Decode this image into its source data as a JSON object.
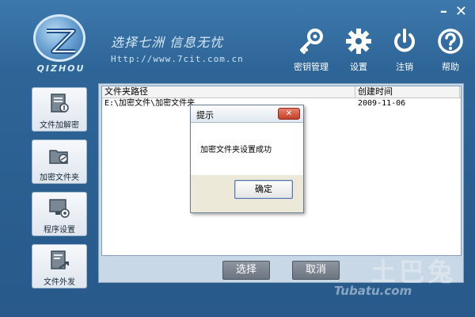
{
  "window": {
    "minimize_icon": "minimize-icon",
    "close_icon": "close-icon",
    "minimize_glyph": "–",
    "close_glyph": "✕"
  },
  "logo": {
    "text": "QIZHOU"
  },
  "slogan": {
    "main": "选择七洲  信息无忧",
    "url": "Http://www.7cit.com.cn"
  },
  "toolbar": {
    "items": [
      {
        "label": "密钥管理",
        "icon": "key-icon"
      },
      {
        "label": "设置",
        "icon": "gear-icon"
      },
      {
        "label": "注销",
        "icon": "power-icon"
      },
      {
        "label": "帮助",
        "icon": "help-icon"
      }
    ]
  },
  "sidebar": {
    "items": [
      {
        "label": "文件加解密",
        "icon": "file-encrypt-icon"
      },
      {
        "label": "加密文件夹",
        "icon": "folder-encrypt-icon"
      },
      {
        "label": "程序设置",
        "icon": "program-settings-icon"
      },
      {
        "label": "文件外发",
        "icon": "file-send-icon"
      }
    ]
  },
  "list": {
    "columns": [
      "文件夹路径",
      "创建时间"
    ],
    "rows": [
      {
        "path": "E:\\加密文件\\加密文件夹",
        "date": "2009-11-06"
      }
    ]
  },
  "buttons": {
    "select": "选择",
    "cancel": "取消"
  },
  "dialog": {
    "title": "提示",
    "close_glyph": "✕",
    "message": "加密文件夹设置成功",
    "ok": "确定"
  },
  "watermark": {
    "big": "土巴兔",
    "small": "Tubatu.com"
  },
  "colors": {
    "background": "#2e6597",
    "accent": "#d6e8f8",
    "close_button": "#c4402a"
  }
}
